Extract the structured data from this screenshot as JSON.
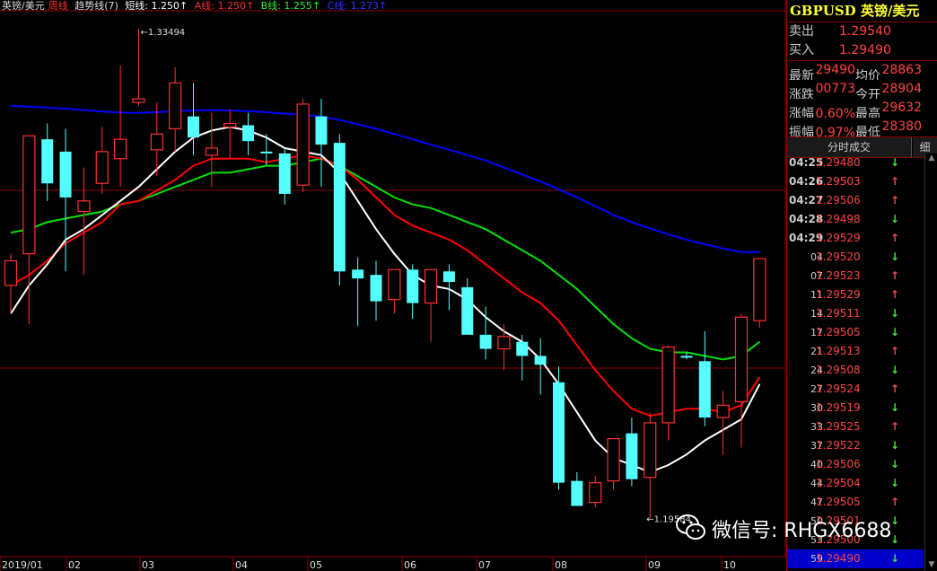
{
  "legend": {
    "title": "英镑/美元",
    "period": "周线",
    "indicator": "趋势线(7)",
    "short": "短线: 1.250↑",
    "a": "A线: 1.250↑",
    "b": "B线: 1.255↑",
    "c": "C线: 1.273↑"
  },
  "colors": {
    "up": "#ff3030",
    "down": "#54ffff",
    "short_line": "#ffffff",
    "a_line": "#ff0000",
    "b_line": "#00e000",
    "c_line": "#0000ff",
    "grid": "#8b0000"
  },
  "annotations": {
    "high": "1.33494",
    "low": "1.19584"
  },
  "x_labels": [
    "2019/01",
    "02",
    "03",
    "04",
    "05",
    "06",
    "07",
    "08",
    "09",
    "10"
  ],
  "chart_data": {
    "type": "candlestick",
    "title": "英镑/美元 周线",
    "ylim": [
      1.185,
      1.34
    ],
    "candles": [
      {
        "o": 1.262,
        "h": 1.271,
        "l": 1.254,
        "c": 1.269
      },
      {
        "o": 1.271,
        "h": 1.304,
        "l": 1.251,
        "c": 1.3045
      },
      {
        "o": 1.3035,
        "h": 1.308,
        "l": 1.286,
        "c": 1.291
      },
      {
        "o": 1.3,
        "h": 1.3065,
        "l": 1.266,
        "c": 1.287
      },
      {
        "o": 1.283,
        "h": 1.2955,
        "l": 1.265,
        "c": 1.286
      },
      {
        "o": 1.291,
        "h": 1.307,
        "l": 1.288,
        "c": 1.3
      },
      {
        "o": 1.298,
        "h": 1.3245,
        "l": 1.29,
        "c": 1.3035
      },
      {
        "o": 1.314,
        "h": 1.3349,
        "l": 1.313,
        "c": 1.315
      },
      {
        "o": 1.3005,
        "h": 1.314,
        "l": 1.293,
        "c": 1.305
      },
      {
        "o": 1.3065,
        "h": 1.324,
        "l": 1.3,
        "c": 1.3195
      },
      {
        "o": 1.31,
        "h": 1.3195,
        "l": 1.299,
        "c": 1.304
      },
      {
        "o": 1.299,
        "h": 1.311,
        "l": 1.29,
        "c": 1.301
      },
      {
        "o": 1.307,
        "h": 1.312,
        "l": 1.298,
        "c": 1.308
      },
      {
        "o": 1.3075,
        "h": 1.311,
        "l": 1.299,
        "c": 1.303
      },
      {
        "o": 1.3,
        "h": 1.305,
        "l": 1.296,
        "c": 1.2995
      },
      {
        "o": 1.2995,
        "h": 1.301,
        "l": 1.285,
        "c": 1.288
      },
      {
        "o": 1.2905,
        "h": 1.315,
        "l": 1.2885,
        "c": 1.3135
      },
      {
        "o": 1.31,
        "h": 1.315,
        "l": 1.29,
        "c": 1.302
      },
      {
        "o": 1.3025,
        "h": 1.305,
        "l": 1.262,
        "c": 1.266
      },
      {
        "o": 1.2665,
        "h": 1.27,
        "l": 1.2505,
        "c": 1.264
      },
      {
        "o": 1.265,
        "h": 1.269,
        "l": 1.252,
        "c": 1.2575
      },
      {
        "o": 1.258,
        "h": 1.266,
        "l": 1.254,
        "c": 1.2665
      },
      {
        "o": 1.2665,
        "h": 1.268,
        "l": 1.2525,
        "c": 1.257
      },
      {
        "o": 1.257,
        "h": 1.2665,
        "l": 1.246,
        "c": 1.2665
      },
      {
        "o": 1.266,
        "h": 1.268,
        "l": 1.255,
        "c": 1.263
      },
      {
        "o": 1.2615,
        "h": 1.264,
        "l": 1.25,
        "c": 1.248
      },
      {
        "o": 1.248,
        "h": 1.256,
        "l": 1.241,
        "c": 1.244
      },
      {
        "o": 1.244,
        "h": 1.251,
        "l": 1.238,
        "c": 1.2475
      },
      {
        "o": 1.246,
        "h": 1.248,
        "l": 1.235,
        "c": 1.242
      },
      {
        "o": 1.242,
        "h": 1.247,
        "l": 1.231,
        "c": 1.2395
      },
      {
        "o": 1.2345,
        "h": 1.239,
        "l": 1.204,
        "c": 1.206
      },
      {
        "o": 1.2065,
        "h": 1.209,
        "l": 1.1998,
        "c": 1.1994
      },
      {
        "o": 1.2004,
        "h": 1.208,
        "l": 1.199,
        "c": 1.206
      },
      {
        "o": 1.2065,
        "h": 1.218,
        "l": 1.204,
        "c": 1.2185
      },
      {
        "o": 1.22,
        "h": 1.2245,
        "l": 1.205,
        "c": 1.207
      },
      {
        "o": 1.2075,
        "h": 1.226,
        "l": 1.1958,
        "c": 1.223
      },
      {
        "o": 1.223,
        "h": 1.245,
        "l": 1.218,
        "c": 1.2445
      },
      {
        "o": 1.242,
        "h": 1.243,
        "l": 1.241,
        "c": 1.2415
      },
      {
        "o": 1.2405,
        "h": 1.249,
        "l": 1.222,
        "c": 1.2245
      },
      {
        "o": 1.2245,
        "h": 1.232,
        "l": 1.214,
        "c": 1.228
      },
      {
        "o": 1.229,
        "h": 1.254,
        "l": 1.216,
        "c": 1.253
      },
      {
        "o": 1.252,
        "h": 1.267,
        "l": 1.25,
        "c": 1.2696
      }
    ],
    "lines": {
      "short": [
        1.254,
        1.262,
        1.268,
        1.275,
        1.278,
        1.282,
        1.286,
        1.29,
        1.295,
        1.3,
        1.304,
        1.306,
        1.307,
        1.306,
        1.304,
        1.301,
        1.3,
        1.299,
        1.294,
        1.286,
        1.278,
        1.271,
        1.265,
        1.262,
        1.261,
        1.258,
        1.253,
        1.249,
        1.246,
        1.241,
        1.234,
        1.226,
        1.218,
        1.213,
        1.211,
        1.209,
        1.211,
        1.214,
        1.218,
        1.221,
        1.224,
        1.234
      ],
      "a": [
        1.262,
        1.265,
        1.269,
        1.274,
        1.277,
        1.28,
        1.285,
        1.286,
        1.289,
        1.292,
        1.296,
        1.298,
        1.298,
        1.298,
        1.297,
        1.298,
        1.299,
        1.298,
        1.296,
        1.292,
        1.287,
        1.282,
        1.279,
        1.277,
        1.275,
        1.272,
        1.268,
        1.264,
        1.26,
        1.257,
        1.252,
        1.245,
        1.238,
        1.232,
        1.227,
        1.225,
        1.226,
        1.227,
        1.227,
        1.226,
        1.228,
        1.236
      ],
      "b": [
        1.277,
        1.278,
        1.28,
        1.281,
        1.282,
        1.283,
        1.285,
        1.286,
        1.288,
        1.29,
        1.292,
        1.294,
        1.294,
        1.295,
        1.296,
        1.296,
        1.297,
        1.298,
        1.296,
        1.293,
        1.29,
        1.287,
        1.285,
        1.284,
        1.282,
        1.28,
        1.278,
        1.275,
        1.272,
        1.269,
        1.265,
        1.261,
        1.256,
        1.251,
        1.247,
        1.244,
        1.243,
        1.243,
        1.242,
        1.241,
        1.242,
        1.246
      ],
      "c": [
        1.313,
        1.3128,
        1.3125,
        1.3122,
        1.3118,
        1.3114,
        1.3111,
        1.311,
        1.3112,
        1.3115,
        1.3117,
        1.3118,
        1.3117,
        1.3115,
        1.3112,
        1.3108,
        1.3105,
        1.31,
        1.309,
        1.3078,
        1.3065,
        1.305,
        1.3035,
        1.302,
        1.3005,
        1.299,
        1.2975,
        1.2955,
        1.2935,
        1.2915,
        1.2893,
        1.287,
        1.2845,
        1.282,
        1.28,
        1.2782,
        1.2765,
        1.275,
        1.2737,
        1.2725,
        1.2715,
        1.2715
      ]
    }
  },
  "quote": {
    "symbol": "GBPUSD",
    "name": "英镑/美元",
    "sell_label": "卖出",
    "sell": "1.29540",
    "buy_label": "买入",
    "buy": "1.29490",
    "last_label": "最新",
    "last": "1.29490",
    "avg_label": "均价",
    "avg": "1.28863",
    "chg_label": "涨跌",
    "chg": "0.00773",
    "open_label": "今开",
    "open": "1.28904",
    "pct_label": "涨幅",
    "pct": "0.60%",
    "high_label": "最高",
    "high": "1.29632",
    "amp_label": "振幅",
    "amp": "0.97%",
    "low_label": "最低",
    "low": "1.28380"
  },
  "tabs": {
    "ticks": "分时成交",
    "detail": "细"
  },
  "ticks": [
    {
      "t": "04:25",
      "p": "1.29480",
      "d": "down",
      "big": true
    },
    {
      "t": "04:26",
      "p": "1.29503",
      "d": "up",
      "big": true
    },
    {
      "t": "04:27",
      "p": "1.29506",
      "d": "up",
      "big": true
    },
    {
      "t": "04:28",
      "p": "1.29498",
      "d": "down",
      "big": true
    },
    {
      "t": "04:29",
      "p": "1.29529",
      "d": "up",
      "big": true
    },
    {
      "t": "04",
      "p": "1.29520",
      "d": "down"
    },
    {
      "t": "07",
      "p": "1.29523",
      "d": "up"
    },
    {
      "t": "11",
      "p": "1.29529",
      "d": "up"
    },
    {
      "t": "14",
      "p": "1.29511",
      "d": "down"
    },
    {
      "t": "17",
      "p": "1.29505",
      "d": "down"
    },
    {
      "t": "21",
      "p": "1.29513",
      "d": "up"
    },
    {
      "t": "24",
      "p": "1.29508",
      "d": "down"
    },
    {
      "t": "27",
      "p": "1.29524",
      "d": "up"
    },
    {
      "t": "30",
      "p": "1.29519",
      "d": "down"
    },
    {
      "t": "33",
      "p": "1.29525",
      "d": "up"
    },
    {
      "t": "37",
      "p": "1.29522",
      "d": "down"
    },
    {
      "t": "40",
      "p": "1.29506",
      "d": "down"
    },
    {
      "t": "44",
      "p": "1.29504",
      "d": "down"
    },
    {
      "t": "47",
      "p": "1.29505",
      "d": "up"
    },
    {
      "t": "50",
      "p": "1.29501",
      "d": "down"
    },
    {
      "t": "53",
      "p": "1.29500",
      "d": "down"
    },
    {
      "t": "59",
      "p": "1.29490",
      "d": "down",
      "sel": true
    }
  ],
  "watermark": "微信号: RHGX6688"
}
